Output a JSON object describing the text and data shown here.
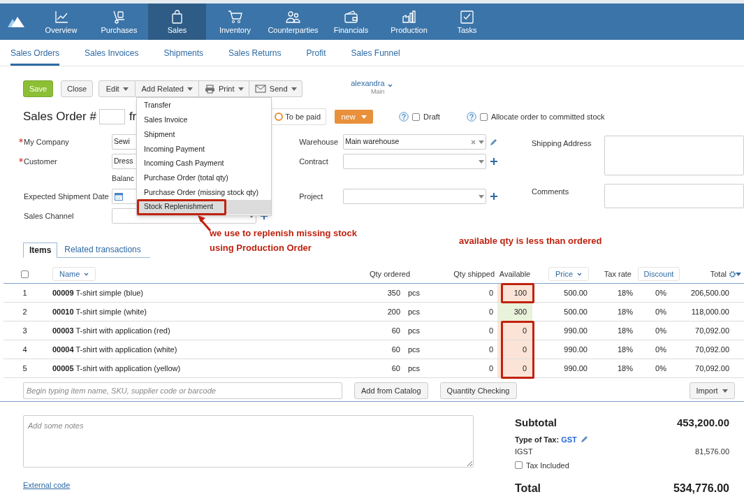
{
  "nav": {
    "items": [
      {
        "label": "Overview",
        "selected": false
      },
      {
        "label": "Purchases",
        "selected": false
      },
      {
        "label": "Sales",
        "selected": true
      },
      {
        "label": "Inventory",
        "selected": false
      },
      {
        "label": "Counterparties",
        "selected": false
      },
      {
        "label": "Financials",
        "selected": false
      },
      {
        "label": "Production",
        "selected": false
      },
      {
        "label": "Tasks",
        "selected": false
      }
    ]
  },
  "subnav": [
    {
      "label": "Sales Orders",
      "selected": true
    },
    {
      "label": "Sales Invoices",
      "selected": false
    },
    {
      "label": "Shipments",
      "selected": false
    },
    {
      "label": "Sales Returns",
      "selected": false
    },
    {
      "label": "Profit",
      "selected": false
    },
    {
      "label": "Sales Funnel",
      "selected": false
    }
  ],
  "toolbar": {
    "save": "Save",
    "close": "Close",
    "menus": [
      "Edit",
      "Add Related",
      "Print",
      "Send"
    ]
  },
  "user": {
    "name": "alexandra",
    "org": "Main"
  },
  "title": {
    "label": "Sales Order #",
    "from": "fr"
  },
  "payment_status": "To be paid",
  "state": "new",
  "options": [
    {
      "label": "Draft",
      "checked": false
    },
    {
      "label": "Allocate order to committed stock",
      "checked": false
    }
  ],
  "form_left": [
    {
      "kind": "select",
      "label": "My Company",
      "required": true,
      "value": "Sewi"
    },
    {
      "kind": "select",
      "label": "Customer",
      "required": true,
      "value": "Dress"
    },
    {
      "kind": "note",
      "value": "Balanc"
    },
    {
      "kind": "date",
      "label": "Expected Shipment Date",
      "required": false
    },
    {
      "kind": "select",
      "label": "Sales Channel",
      "required": false,
      "addable": true
    }
  ],
  "form_mid": [
    {
      "label": "Warehouse",
      "value": "Main warehouse",
      "clearable": true,
      "editable": true,
      "addable": false
    },
    {
      "label": "Contract",
      "clearable": false,
      "editable": false,
      "addable": true
    },
    {
      "label": "Project",
      "clearable": false,
      "editable": false,
      "addable": true
    }
  ],
  "form_right": [
    {
      "label": "Shipping Address",
      "tall": true
    },
    {
      "label": "Comments",
      "tall": false
    }
  ],
  "add_related_menu": [
    {
      "label": "Transfer",
      "selected": false
    },
    {
      "label": "Sales Invoice",
      "selected": false
    },
    {
      "label": "Shipment",
      "selected": false
    },
    {
      "label": "Incoming Payment",
      "selected": false
    },
    {
      "label": "Incoming Cash Payment",
      "selected": false
    },
    {
      "label": "Purchase Order (total qty)",
      "selected": false
    },
    {
      "label": "Purchase Order (missing stock qty)",
      "selected": false
    },
    {
      "label": "Stock Replenishment",
      "selected": true
    }
  ],
  "annotations": [
    {
      "kind": "menu",
      "lines": [
        "we use to replenish missing stock",
        "using Production Order"
      ]
    },
    {
      "kind": "table",
      "lines": [
        "available qty is less than ordered"
      ]
    }
  ],
  "tabs": [
    {
      "label": "Items",
      "selected": true
    },
    {
      "label": "Related transactions",
      "selected": false
    }
  ],
  "table": {
    "select_all": {
      "checked": false
    },
    "columns": [
      {
        "label": "Name",
        "kind": "sort"
      },
      {
        "label": "Qty ordered",
        "kind": "plain"
      },
      {
        "label": "Qty shipped",
        "kind": "plain"
      },
      {
        "label": "Available",
        "kind": "plain"
      },
      {
        "label": "Price",
        "kind": "sort"
      },
      {
        "label": "Tax rate",
        "kind": "plain"
      },
      {
        "label": "Discount",
        "kind": "button"
      },
      {
        "label": "Total",
        "kind": "settings"
      }
    ],
    "rows": [
      {
        "num": "1",
        "name": "**00009** T-shirt simple (blue)",
        "qty": "350",
        "unit": "pcs",
        "shipped": "0",
        "available": "100",
        "enough": false,
        "flagged": true,
        "price": "500.00",
        "tax": "18%",
        "discount": "0%",
        "total": "206,500.00"
      },
      {
        "num": "2",
        "name": "**00010** T-shirt simple (white)",
        "qty": "200",
        "unit": "pcs",
        "shipped": "0",
        "available": "300",
        "enough": true,
        "flagged": false,
        "price": "500.00",
        "tax": "18%",
        "discount": "0%",
        "total": "118,000.00"
      },
      {
        "num": "3",
        "name": "**00003** T-shirt with application (red)",
        "qty": "60",
        "unit": "pcs",
        "shipped": "0",
        "available": "0",
        "enough": false,
        "flagged": true,
        "price": "990.00",
        "tax": "18%",
        "discount": "0%",
        "total": "70,092.00"
      },
      {
        "num": "4",
        "name": "**00004** T-shirt with application (white)",
        "qty": "60",
        "unit": "pcs",
        "shipped": "0",
        "available": "0",
        "enough": false,
        "flagged": true,
        "price": "990.00",
        "tax": "18%",
        "discount": "0%",
        "total": "70,092.00"
      },
      {
        "num": "5",
        "name": "**00005** T-shirt with application (yellow)",
        "qty": "60",
        "unit": "pcs",
        "shipped": "0",
        "available": "0",
        "enough": false,
        "flagged": true,
        "price": "990.00",
        "tax": "18%",
        "discount": "0%",
        "total": "70,092.00"
      }
    ]
  },
  "item_entry": {
    "placeholder": "Begin typing item name, SKU, supplier code or barcode",
    "buttons": [
      "Add from Catalog",
      "Quantity Checking"
    ],
    "import": "Import"
  },
  "notes": {
    "placeholder": "Add some notes",
    "link": "External code"
  },
  "totals": {
    "subtotal_label": "Subtotal",
    "subtotal": "453,200.00",
    "tax_type_label": "Type of Tax:",
    "tax_type": "GST",
    "tax_name": "IGST",
    "tax_value": "81,576.00",
    "tax_included": {
      "label": "Tax Included",
      "checked": false
    },
    "total_label": "Total",
    "total": "534,776.00"
  }
}
